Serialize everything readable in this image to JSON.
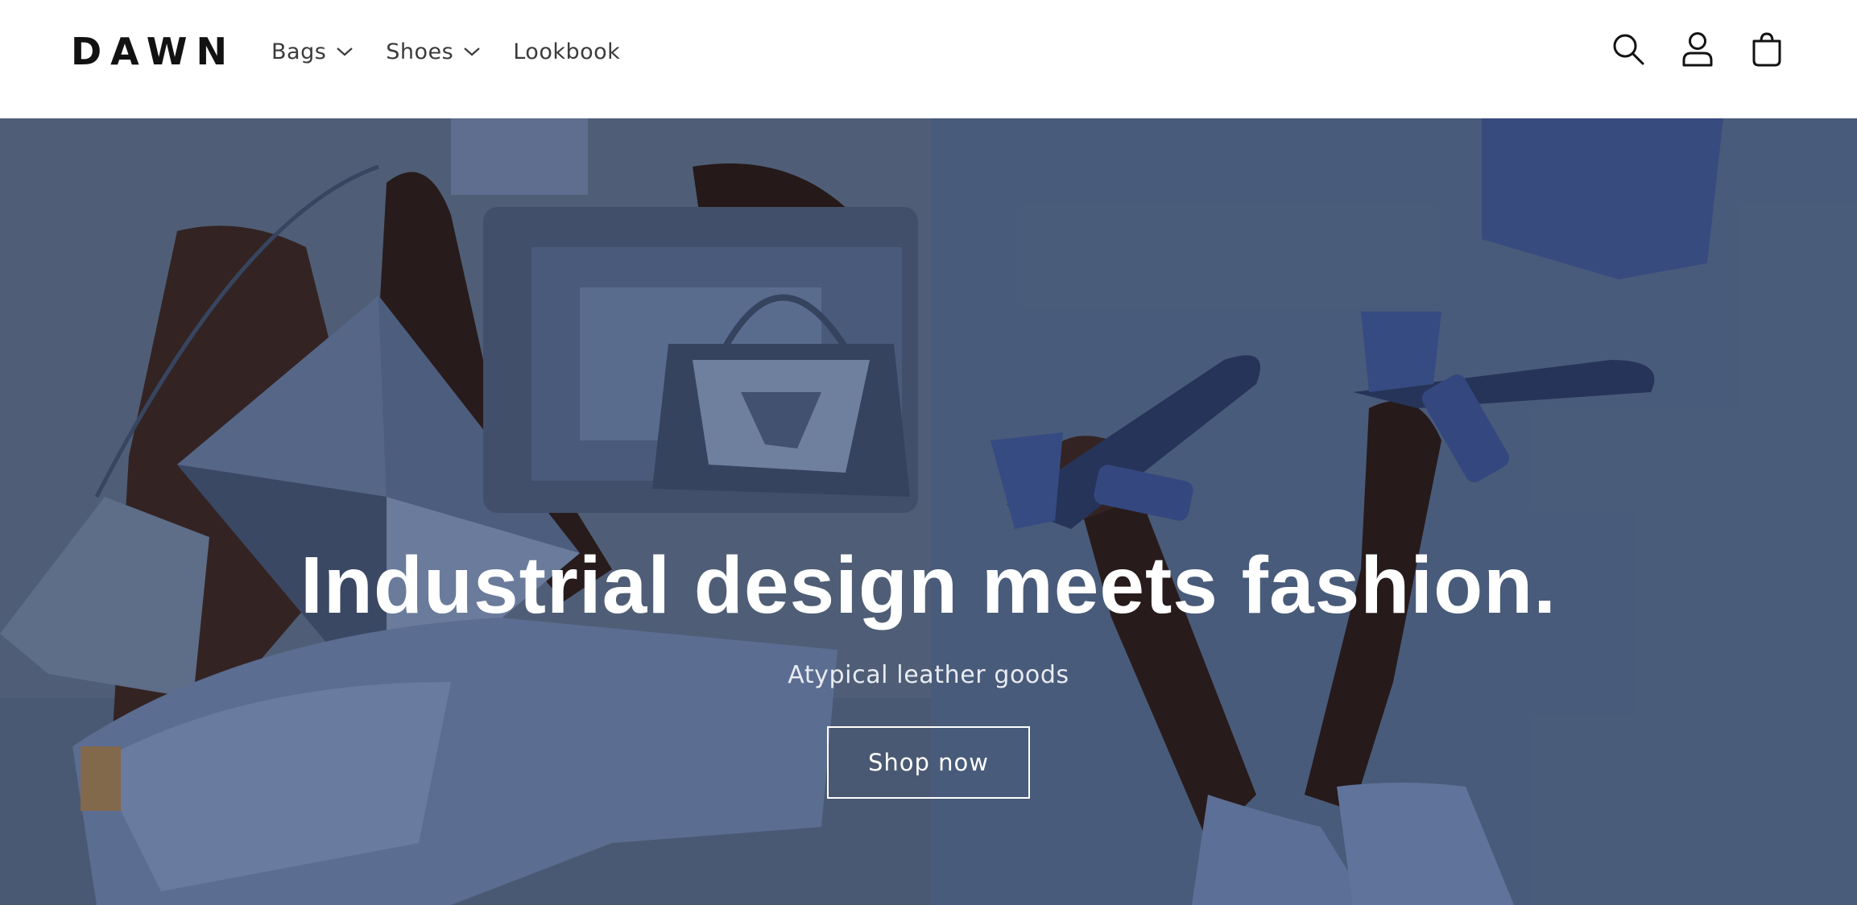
{
  "header": {
    "logo": "DAWN",
    "nav": [
      {
        "label": "Bags",
        "has_dropdown": true
      },
      {
        "label": "Shoes",
        "has_dropdown": true
      },
      {
        "label": "Lookbook",
        "has_dropdown": false
      }
    ],
    "icons": [
      "search-icon",
      "account-icon",
      "cart-icon"
    ]
  },
  "hero": {
    "title": "Industrial design meets fashion.",
    "subtitle": "Atypical leather goods",
    "button_label": "Shop now"
  },
  "colors": {
    "text_dark": "#121212",
    "nav_text": "#3b3b3b",
    "hero_bg": "#5a6c86",
    "hero_text": "#ffffff"
  }
}
